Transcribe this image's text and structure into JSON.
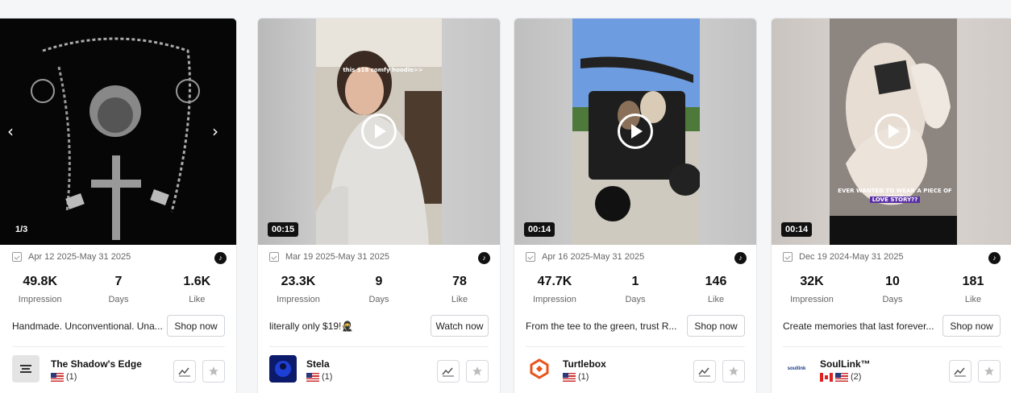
{
  "cards": [
    {
      "media_counter": "1/3",
      "date_range": "Apr 12 2025-May 31 2025",
      "platform_icon": "tiktok-icon",
      "impression": "49.8K",
      "impression_label": "Impression",
      "days": "7",
      "days_label": "Days",
      "like": "1.6K",
      "like_label": "Like",
      "description": "Handmade. Unconventional. Una...",
      "shop_button": "Shop now",
      "shop_name": "The Shadow's Edge",
      "flag_count": "(1)"
    },
    {
      "duration": "00:15",
      "overlay_caption": "this $18 comfy hoodie>>",
      "date_range": "Mar 19 2025-May 31 2025",
      "platform_icon": "tiktok-icon",
      "impression": "23.3K",
      "impression_label": "Impression",
      "days": "9",
      "days_label": "Days",
      "like": "78",
      "like_label": "Like",
      "description": "literally only $19!🥷",
      "shop_button": "Watch now",
      "shop_name": "Stela",
      "flag_count": "(1)"
    },
    {
      "duration": "00:14",
      "date_range": "Apr 16 2025-May 31 2025",
      "platform_icon": "tiktok-icon",
      "impression": "47.7K",
      "impression_label": "Impression",
      "days": "1",
      "days_label": "Days",
      "like": "146",
      "like_label": "Like",
      "description": "From the tee to the green, trust R...",
      "shop_button": "Shop now",
      "shop_name": "Turtlebox",
      "flag_count": "(1)"
    },
    {
      "duration": "00:14",
      "overlay_caption_1": "EVER WANTED TO WEAR A PIECE OF YOUR",
      "overlay_caption_2": "LOVE STORY??",
      "date_range": "Dec 19 2024-May 31 2025",
      "platform_icon": "tiktok-icon",
      "impression": "32K",
      "impression_label": "Impression",
      "days": "10",
      "days_label": "Days",
      "like": "181",
      "like_label": "Like",
      "description": "Create memories that last forever...",
      "shop_button": "Shop now",
      "shop_name": "SoulLink™",
      "logo_text": "soullink",
      "flag_count": "(2)"
    }
  ]
}
